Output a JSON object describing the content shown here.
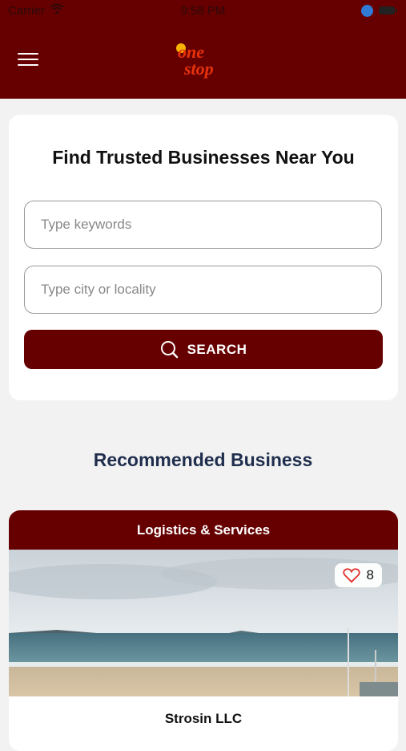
{
  "status_bar": {
    "carrier": "Carrier",
    "time": "9:58 PM"
  },
  "header": {
    "logo_icon": "onestop-logo",
    "logo_text_top": "one",
    "logo_text_bottom": "stop",
    "brand_color": "#660000"
  },
  "search": {
    "title": "Find Trusted Businesses Near You",
    "keywords_placeholder": "Type keywords",
    "city_placeholder": "Type city or locality",
    "button_label": "SEARCH",
    "button_icon": "search-icon"
  },
  "recommended": {
    "title": "Recommended Business",
    "title_color": "#1f2e4d",
    "card": {
      "category": "Logistics & Services",
      "likes": "8",
      "like_icon": "heart-icon",
      "name": "Strosin LLC"
    }
  }
}
